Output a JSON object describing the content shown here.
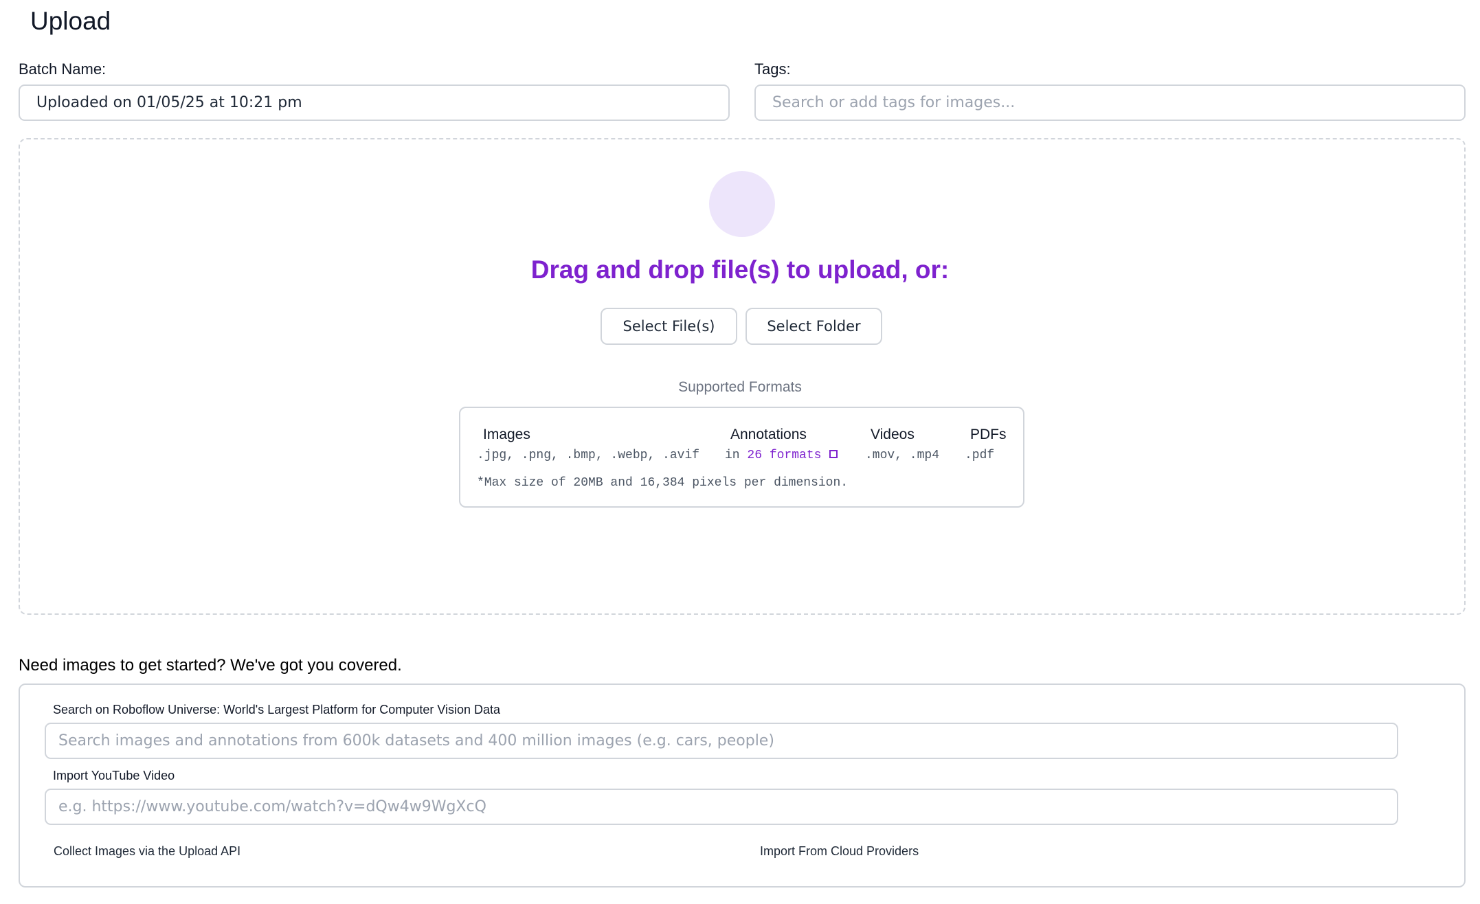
{
  "page": {
    "title": "Upload"
  },
  "batch": {
    "label": "Batch Name:",
    "value": "Uploaded on 01/05/25 at 10:21 pm"
  },
  "tags": {
    "label": "Tags:",
    "placeholder": "Search or add tags for images..."
  },
  "dropzone": {
    "headline": "Drag and drop file(s) to upload, or:",
    "select_files_label": "Select File(s)",
    "select_folder_label": "Select Folder",
    "upload_icon": "upload-circle-icon",
    "accent_color": "#7e22ce"
  },
  "formats": {
    "title": "Supported Formats",
    "images": {
      "heading": "Images",
      "value": ".jpg, .png, .bmp, .webp, .avif"
    },
    "annotations": {
      "heading": "Annotations",
      "prefix": "in",
      "link": "26 formats",
      "icon": "external-link-icon"
    },
    "videos": {
      "heading": "Videos",
      "value": ".mov, .mp4"
    },
    "pdfs": {
      "heading": "PDFs",
      "value": ".pdf"
    },
    "note": "*Max size of 20MB and 16,384 pixels per dimension."
  },
  "resources": {
    "heading": "Need images to get started? We've got you covered.",
    "universe": {
      "label": "Search on Roboflow Universe: World's Largest Platform for Computer Vision Data",
      "placeholder": "Search images and annotations from 600k datasets and 400 million images (e.g. cars, people)"
    },
    "youtube": {
      "label": "Import YouTube Video",
      "placeholder": "e.g. https://www.youtube.com/watch?v=dQw4w9WgXcQ"
    },
    "upload_api_label": "Collect Images via the Upload API",
    "cloud_label": "Import From Cloud Providers"
  }
}
